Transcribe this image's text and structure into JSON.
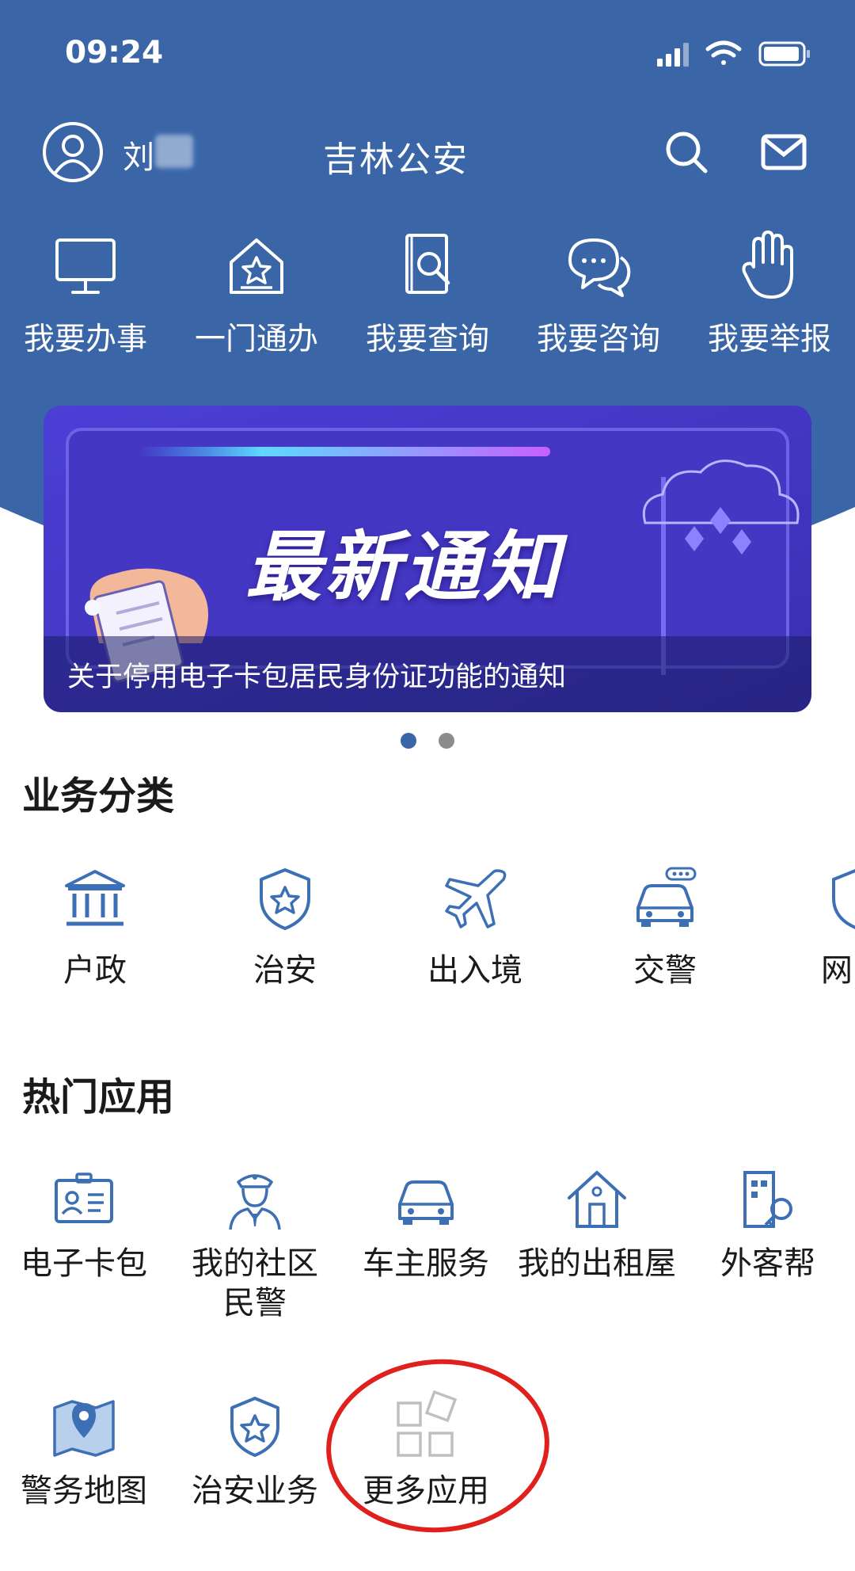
{
  "status_bar": {
    "time": "09:24"
  },
  "header": {
    "user_name": "刘",
    "app_title": "吉林公安",
    "colors": {
      "background": "#3a66a8",
      "text": "#ffffff"
    }
  },
  "quick_actions": [
    {
      "icon": "monitor-icon",
      "label": "我要办事"
    },
    {
      "icon": "house-star-icon",
      "label": "一门通办"
    },
    {
      "icon": "document-search-icon",
      "label": "我要查询"
    },
    {
      "icon": "chat-bubbles-icon",
      "label": "我要咨询"
    },
    {
      "icon": "raised-hand-icon",
      "label": "我要举报"
    }
  ],
  "banner": {
    "headline": "最新通知",
    "caption": "关于停用电子卡包居民身份证功能的通知",
    "page_count": 2,
    "active_page": 1
  },
  "categories": {
    "title": "业务分类",
    "items": [
      {
        "icon": "bank-icon",
        "label": "户政"
      },
      {
        "icon": "police-badge-icon",
        "label": "治安"
      },
      {
        "icon": "airplane-icon",
        "label": "出入境"
      },
      {
        "icon": "car-icon",
        "label": "交警"
      },
      {
        "icon": "globe-shield-icon",
        "label": "网"
      }
    ]
  },
  "hot_apps": {
    "title": "热门应用",
    "items": [
      {
        "icon": "id-card-icon",
        "label": "电子卡包"
      },
      {
        "icon": "police-officer-icon",
        "label": "我的社区民警"
      },
      {
        "icon": "car-icon",
        "label": "车主服务"
      },
      {
        "icon": "house-icon",
        "label": "我的出租屋"
      },
      {
        "icon": "building-key-icon",
        "label": "外客帮"
      },
      {
        "icon": "map-pin-icon",
        "label": "警务地图"
      },
      {
        "icon": "police-badge-icon",
        "label": "治安业务"
      },
      {
        "icon": "grid-apps-icon",
        "label": "更多应用"
      }
    ]
  },
  "accent_colors": {
    "icon_blue": "#3d6fb5",
    "annotation_red": "#e0201c"
  }
}
